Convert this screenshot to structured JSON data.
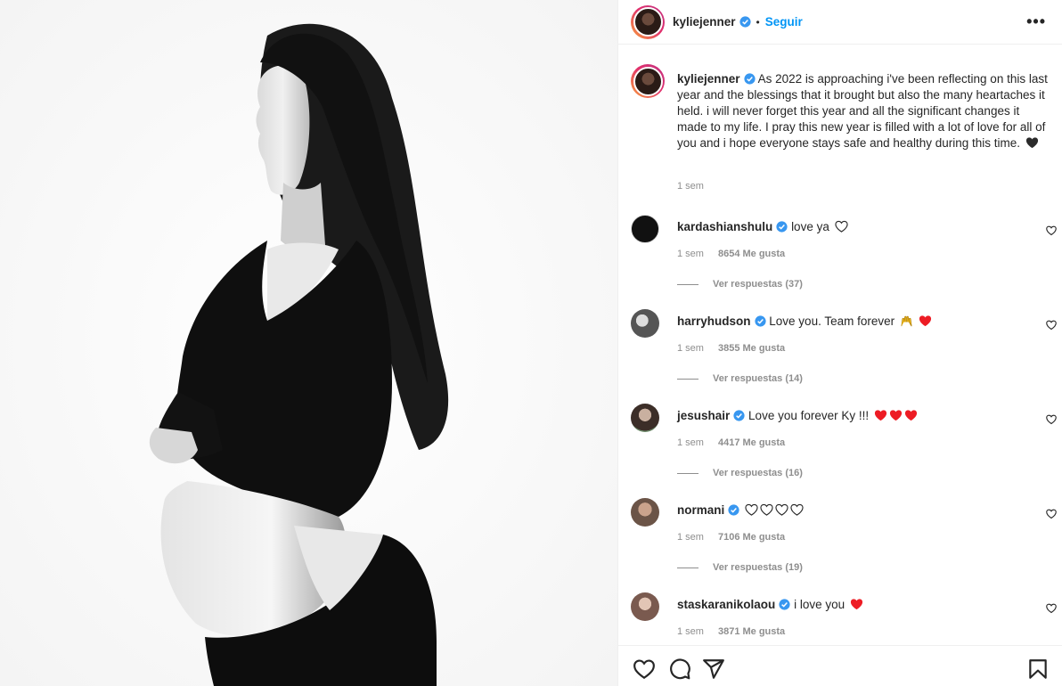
{
  "post": {
    "author": "kyliejenner",
    "follow_label": "Seguir",
    "more_label": "•••",
    "separator": "•"
  },
  "caption": {
    "username": "kyliejenner",
    "text": "As 2022 is approaching i've been reflecting on this last year and the blessings that it brought but also the many heartaches it held. i will never forget this year and all the significant changes it made to my life. I pray this new year is filled with a lot of love for all of you and i hope everyone stays safe and healthy during this time.",
    "emoji": "black-heart",
    "time": "1 sem"
  },
  "comments": [
    {
      "username": "kardashianshulu",
      "text": "love ya",
      "emojis": [
        "white-heart"
      ],
      "time": "1 sem",
      "likes": "8654 Me gusta",
      "replies": "Ver respuestas (37)",
      "avatar_color": "#111111"
    },
    {
      "username": "harryhudson",
      "text": "Love you. Team forever",
      "emojis": [
        "raised-hands",
        "red-heart"
      ],
      "time": "1 sem",
      "likes": "3855 Me gusta",
      "replies": "Ver respuestas (14)",
      "avatar_color": "#777777"
    },
    {
      "username": "jesushair",
      "text": "Love you forever Ky !!!",
      "emojis": [
        "red-heart",
        "red-heart",
        "red-heart"
      ],
      "time": "1 sem",
      "likes": "4417 Me gusta",
      "replies": "Ver respuestas (16)",
      "avatar_color": "#b39a86"
    },
    {
      "username": "normani",
      "text": "",
      "emojis": [
        "white-heart",
        "white-heart",
        "white-heart",
        "white-heart"
      ],
      "time": "1 sem",
      "likes": "7106 Me gusta",
      "replies": "Ver respuestas (19)",
      "avatar_color": "#a98a76"
    },
    {
      "username": "staskaranikolaou",
      "text": "i love you",
      "emojis": [
        "red-heart"
      ],
      "time": "1 sem",
      "likes": "3871 Me gusta",
      "replies": "",
      "avatar_color": "#8a6b5e"
    }
  ],
  "actions": [
    "like-icon",
    "comment-icon",
    "share-icon",
    "save-icon"
  ],
  "colors": {
    "accent": "#0095f6",
    "verified": "#3897f0",
    "muted": "#8e8e8e",
    "heart_red": "#ed1c24"
  }
}
